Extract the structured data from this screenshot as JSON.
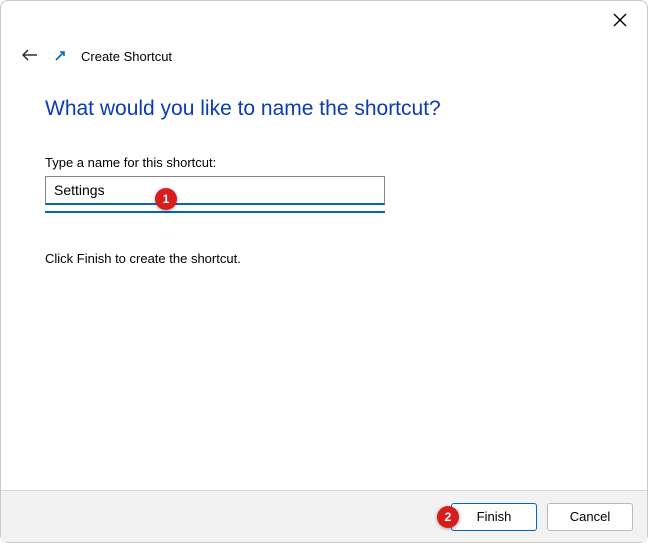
{
  "window": {
    "title": "Create Shortcut"
  },
  "page": {
    "heading": "What would you like to name the shortcut?",
    "field_label": "Type a name for this shortcut:",
    "input_value": "Settings",
    "hint": "Click Finish to create the shortcut."
  },
  "buttons": {
    "finish": "Finish",
    "cancel": "Cancel"
  },
  "callouts": {
    "one": "1",
    "two": "2"
  }
}
